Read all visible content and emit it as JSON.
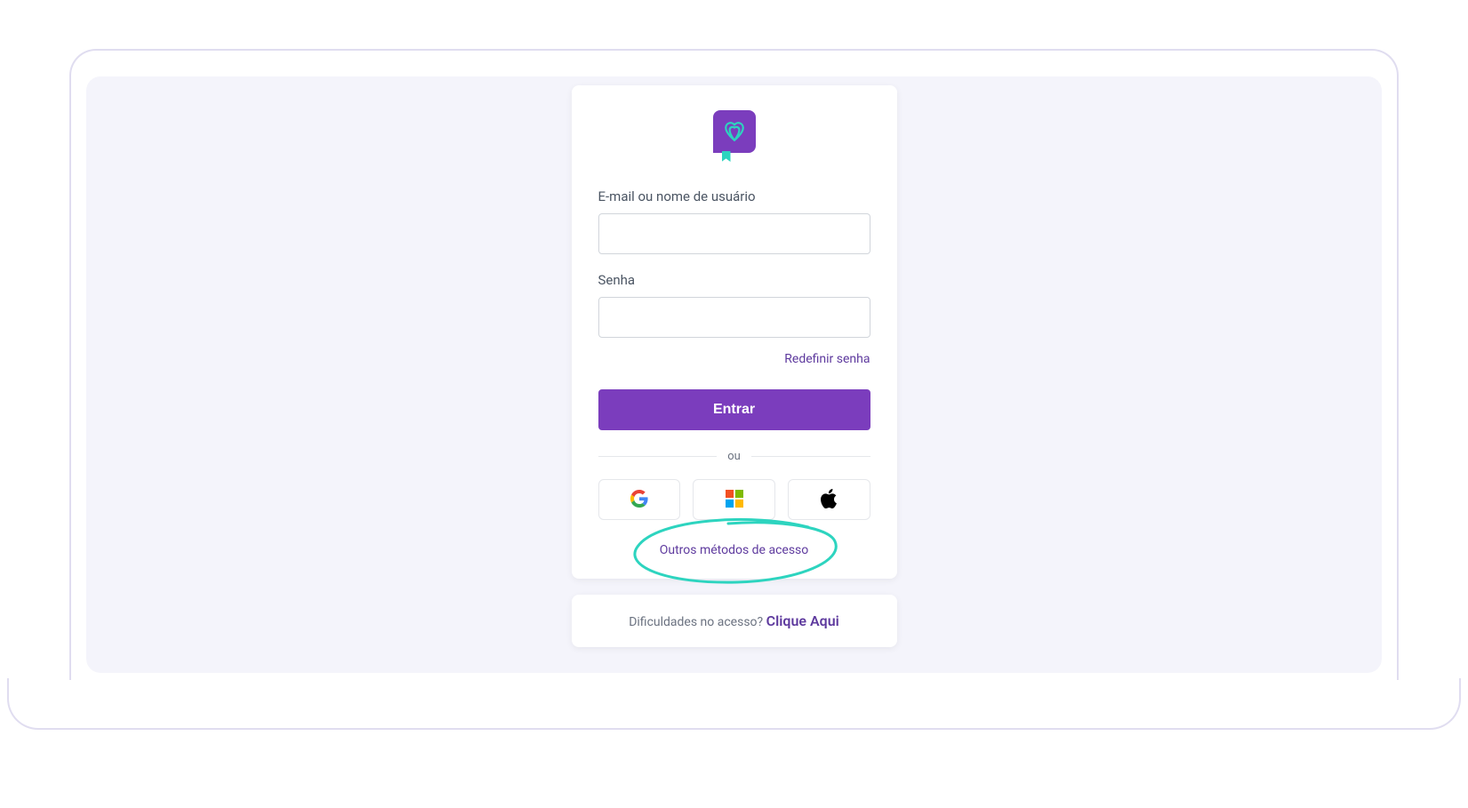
{
  "form": {
    "username_label": "E-mail ou nome de usuário",
    "username_value": "",
    "password_label": "Senha",
    "password_value": "",
    "reset_link": "Redefinir senha",
    "submit_label": "Entrar",
    "divider_text": "ou",
    "other_methods": "Outros métodos de acesso"
  },
  "social": {
    "google": "google-icon",
    "microsoft": "microsoft-icon",
    "apple": "apple-icon"
  },
  "help": {
    "prefix": "Dificuldades no acesso? ",
    "link": "Clique Aqui"
  },
  "colors": {
    "primary": "#7b3dbd",
    "accent": "#2dd4bf",
    "highlight": "#2dd4bf"
  }
}
